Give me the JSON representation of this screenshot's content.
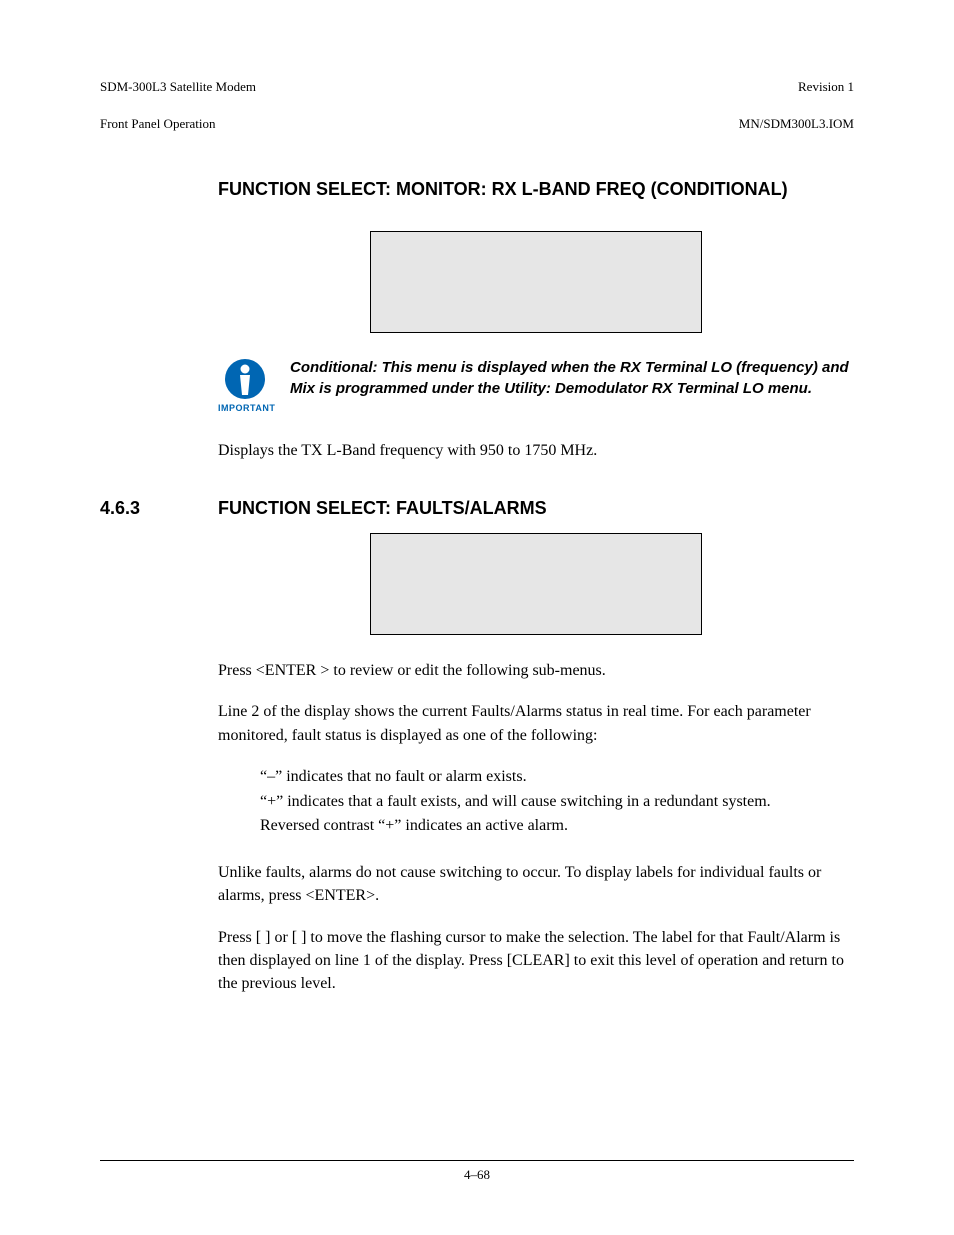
{
  "header": {
    "leftLine1": "SDM-300L3 Satellite Modem",
    "leftLine2": "Front Panel Operation",
    "rightLine1": "Revision 1",
    "rightLine2": "MN/SDM300L3.IOM"
  },
  "section1": {
    "title": "FUNCTION SELECT: MONITOR: RX L-BAND FREQ (CONDITIONAL)",
    "importantLabel": "IMPORTANT",
    "importantText": "Conditional: This menu is displayed when the RX Terminal LO (frequency) and Mix is programmed under the Utility: Demodulator RX Terminal LO menu.",
    "body": "Displays the TX L-Band frequency with 950 to 1750 MHz."
  },
  "section2": {
    "number": "4.6.3",
    "title": "FUNCTION SELECT: FAULTS/ALARMS",
    "p1": "Press <ENTER > to review or edit the following sub-menus.",
    "p2": "Line 2 of the display shows the current Faults/Alarms status in real time. For each parameter monitored, fault status is displayed as one of the following:",
    "li1": "“–” indicates that no fault or alarm exists.",
    "li2": "“+” indicates that a fault exists, and will cause switching in a redundant system.",
    "li3": "Reversed contrast “+” indicates an active alarm.",
    "p3": "Unlike faults, alarms do not cause switching to occur. To display labels for individual faults or alarms, press <ENTER>.",
    "p4": "Press [   ] or [   ] to move the flashing cursor to make the selection. The label for that Fault/Alarm is then displayed on line 1 of the display. Press [CLEAR] to exit this level of operation and return to the previous level."
  },
  "footer": {
    "pageNumber": "4–68"
  }
}
